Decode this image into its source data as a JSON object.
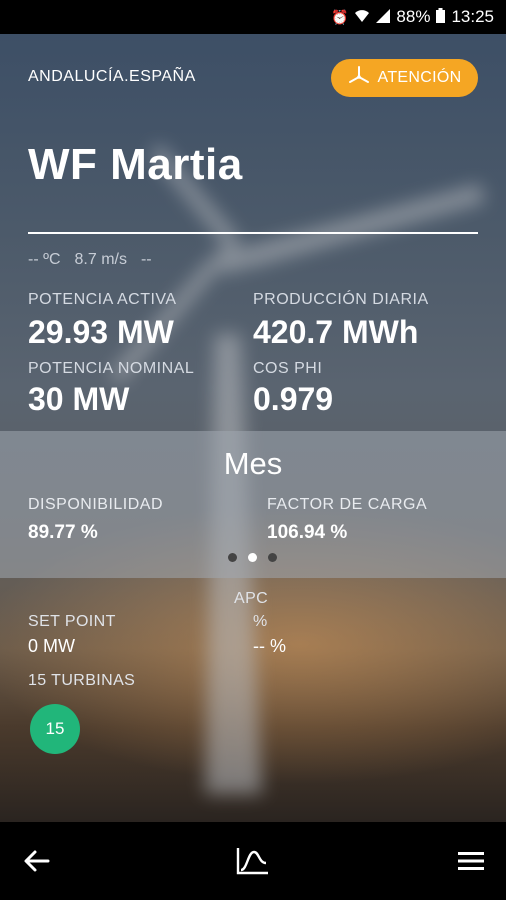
{
  "status_bar": {
    "battery": "88%",
    "time": "13:25"
  },
  "header": {
    "region": "ANDALUCÍA.ESPAÑA",
    "alert_label": "ATENCIÓN",
    "title": "WF Martia"
  },
  "weather": {
    "temperature": "-- ºC",
    "wind": "8.7 m/s",
    "direction": "--"
  },
  "metrics": {
    "active_power_label": "POTENCIA ACTIVA",
    "active_power_value": "29.93 MW",
    "daily_production_label": "PRODUCCIÓN DIARIA",
    "daily_production_value": "420.7 MWh",
    "nominal_power_label": "POTENCIA NOMINAL",
    "nominal_power_value": "30 MW",
    "cos_phi_label": "COS PHI",
    "cos_phi_value": "0.979"
  },
  "month_panel": {
    "title": "Mes",
    "availability_label": "DISPONIBILIDAD",
    "availability_value": "89.77 %",
    "load_factor_label": "FACTOR DE CARGA",
    "load_factor_value": "106.94 %",
    "active_page": 2,
    "pages": 3
  },
  "apc": {
    "title": "APC",
    "set_point_label": "SET POINT",
    "set_point_value": "0 MW",
    "percent_label": "%",
    "percent_value": "-- %"
  },
  "turbines": {
    "label": "15 TURBINAS",
    "count": "15"
  },
  "nav": {
    "back_icon": "arrow-left-icon",
    "chart_icon": "chart-icon",
    "menu_icon": "menu-icon"
  },
  "colors": {
    "alert": "#f5a623",
    "turbine_ok": "#21b67a"
  }
}
